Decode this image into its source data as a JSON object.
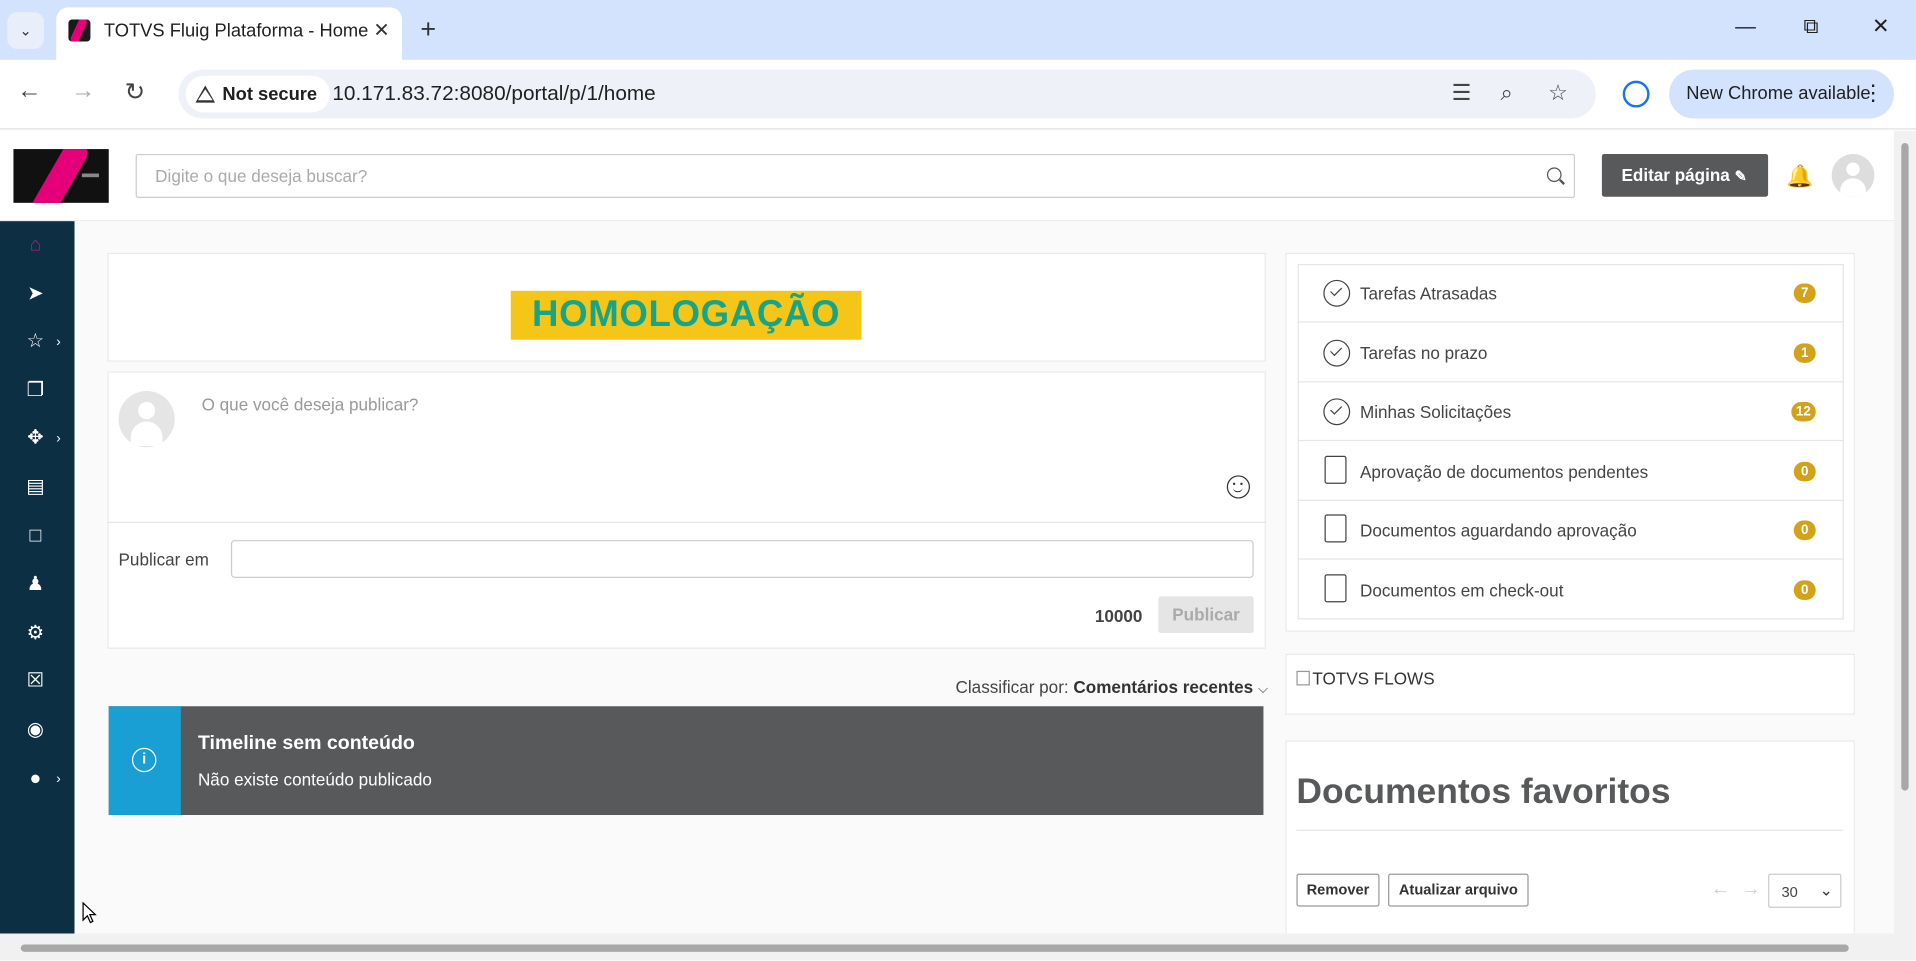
{
  "browser": {
    "tab_title": "TOTVS Fluig Plataforma - Home",
    "new_tab_symbol": "+",
    "not_secure_label": "Not secure",
    "url": "10.171.83.72:8080/portal/p/1/home",
    "update_label": "New Chrome available"
  },
  "header": {
    "search_placeholder": "Digite o que deseja buscar?",
    "edit_page_label": "Editar página"
  },
  "sidebar": {
    "items": [
      {
        "icon": "home-icon"
      },
      {
        "icon": "rocket-icon"
      },
      {
        "icon": "star-icon",
        "has_submenu": true
      },
      {
        "icon": "documents-icon"
      },
      {
        "icon": "process-icon",
        "has_submenu": true
      },
      {
        "icon": "monitor-icon"
      },
      {
        "icon": "chat-icon"
      },
      {
        "icon": "users-icon"
      },
      {
        "icon": "gear-icon"
      },
      {
        "icon": "trash-icon"
      },
      {
        "icon": "fire-icon"
      },
      {
        "icon": "globe-icon",
        "has_submenu": true
      }
    ],
    "active_color": "#e5007a"
  },
  "main": {
    "environment_banner": "HOMOLOGAÇÃO",
    "post_placeholder": "O que você deseja publicar?",
    "publish_in_label": "Publicar em",
    "char_count": "10000",
    "publish_button": "Publicar",
    "sort_label": "Classificar por:",
    "sort_value": "Comentários recentes",
    "timeline_empty_title": "Timeline sem conteúdo",
    "timeline_empty_text": "Não existe conteúdo publicado"
  },
  "tasks": [
    {
      "label": "Tarefas Atrasadas",
      "count": "7",
      "icon": "clock-check-icon"
    },
    {
      "label": "Tarefas no prazo",
      "count": "1",
      "icon": "clock-check-icon"
    },
    {
      "label": "Minhas Solicitações",
      "count": "12",
      "icon": "user-clock-icon"
    },
    {
      "label": "Aprovação de documentos pendentes",
      "count": "0",
      "icon": "document-check-icon"
    },
    {
      "label": "Documentos aguardando aprovação",
      "count": "0",
      "icon": "document-user-icon"
    },
    {
      "label": "Documentos em check-out",
      "count": "0",
      "icon": "document-lock-icon"
    }
  ],
  "flows_image_alt": "TOTVS FLOWS",
  "favorites": {
    "title": "Documentos favoritos",
    "remove_button": "Remover",
    "update_button": "Atualizar arquivo",
    "page_size": "30"
  },
  "colors": {
    "badge": "#d4a21a",
    "sidebar_bg": "#0d2f44",
    "banner_bg": "#f5c518",
    "banner_text": "#17a589",
    "alert_bg": "#58595b",
    "alert_icon_bg": "#1a9fd4"
  }
}
